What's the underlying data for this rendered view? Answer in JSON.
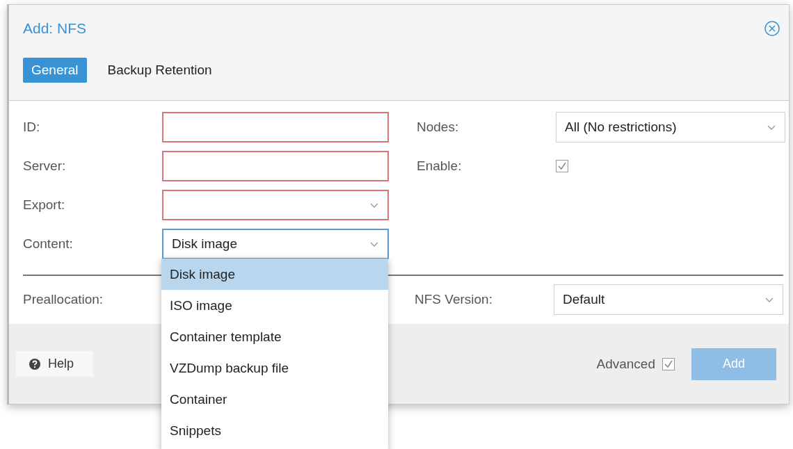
{
  "dialog": {
    "title": "Add: NFS"
  },
  "tabs": [
    {
      "label": "General",
      "selected": true
    },
    {
      "label": "Backup Retention",
      "selected": false
    }
  ],
  "left_fields": [
    {
      "label": "ID:",
      "kind": "text",
      "invalid": true,
      "focused": false
    },
    {
      "label": "Server:",
      "kind": "text",
      "invalid": true,
      "focused": false
    },
    {
      "label": "Export:",
      "kind": "combo",
      "invalid": true,
      "focused": false
    },
    {
      "label": "Content:",
      "kind": "combo",
      "invalid": false,
      "focused": true,
      "value": "Disk image"
    }
  ],
  "right_fields": [
    {
      "label": "Nodes:",
      "kind": "combo",
      "value": "All (No restrictions)"
    },
    {
      "label": "Enable:",
      "kind": "checkbox",
      "checked": true
    }
  ],
  "advanced_left": {
    "label": "Preallocation:"
  },
  "advanced_right": {
    "label": "NFS Version:",
    "kind": "combo",
    "value": "Default"
  },
  "content_options": [
    {
      "label": "Disk image",
      "selected": true
    },
    {
      "label": "ISO image",
      "selected": false
    },
    {
      "label": "Container template",
      "selected": false
    },
    {
      "label": "VZDump backup file",
      "selected": false
    },
    {
      "label": "Container",
      "selected": false
    },
    {
      "label": "Snippets",
      "selected": false
    }
  ],
  "footer": {
    "help_button": {
      "label": "Help"
    },
    "advanced": {
      "label": "Advanced",
      "checked": true
    },
    "add_button": {
      "label": "Add",
      "disabled": true
    }
  }
}
